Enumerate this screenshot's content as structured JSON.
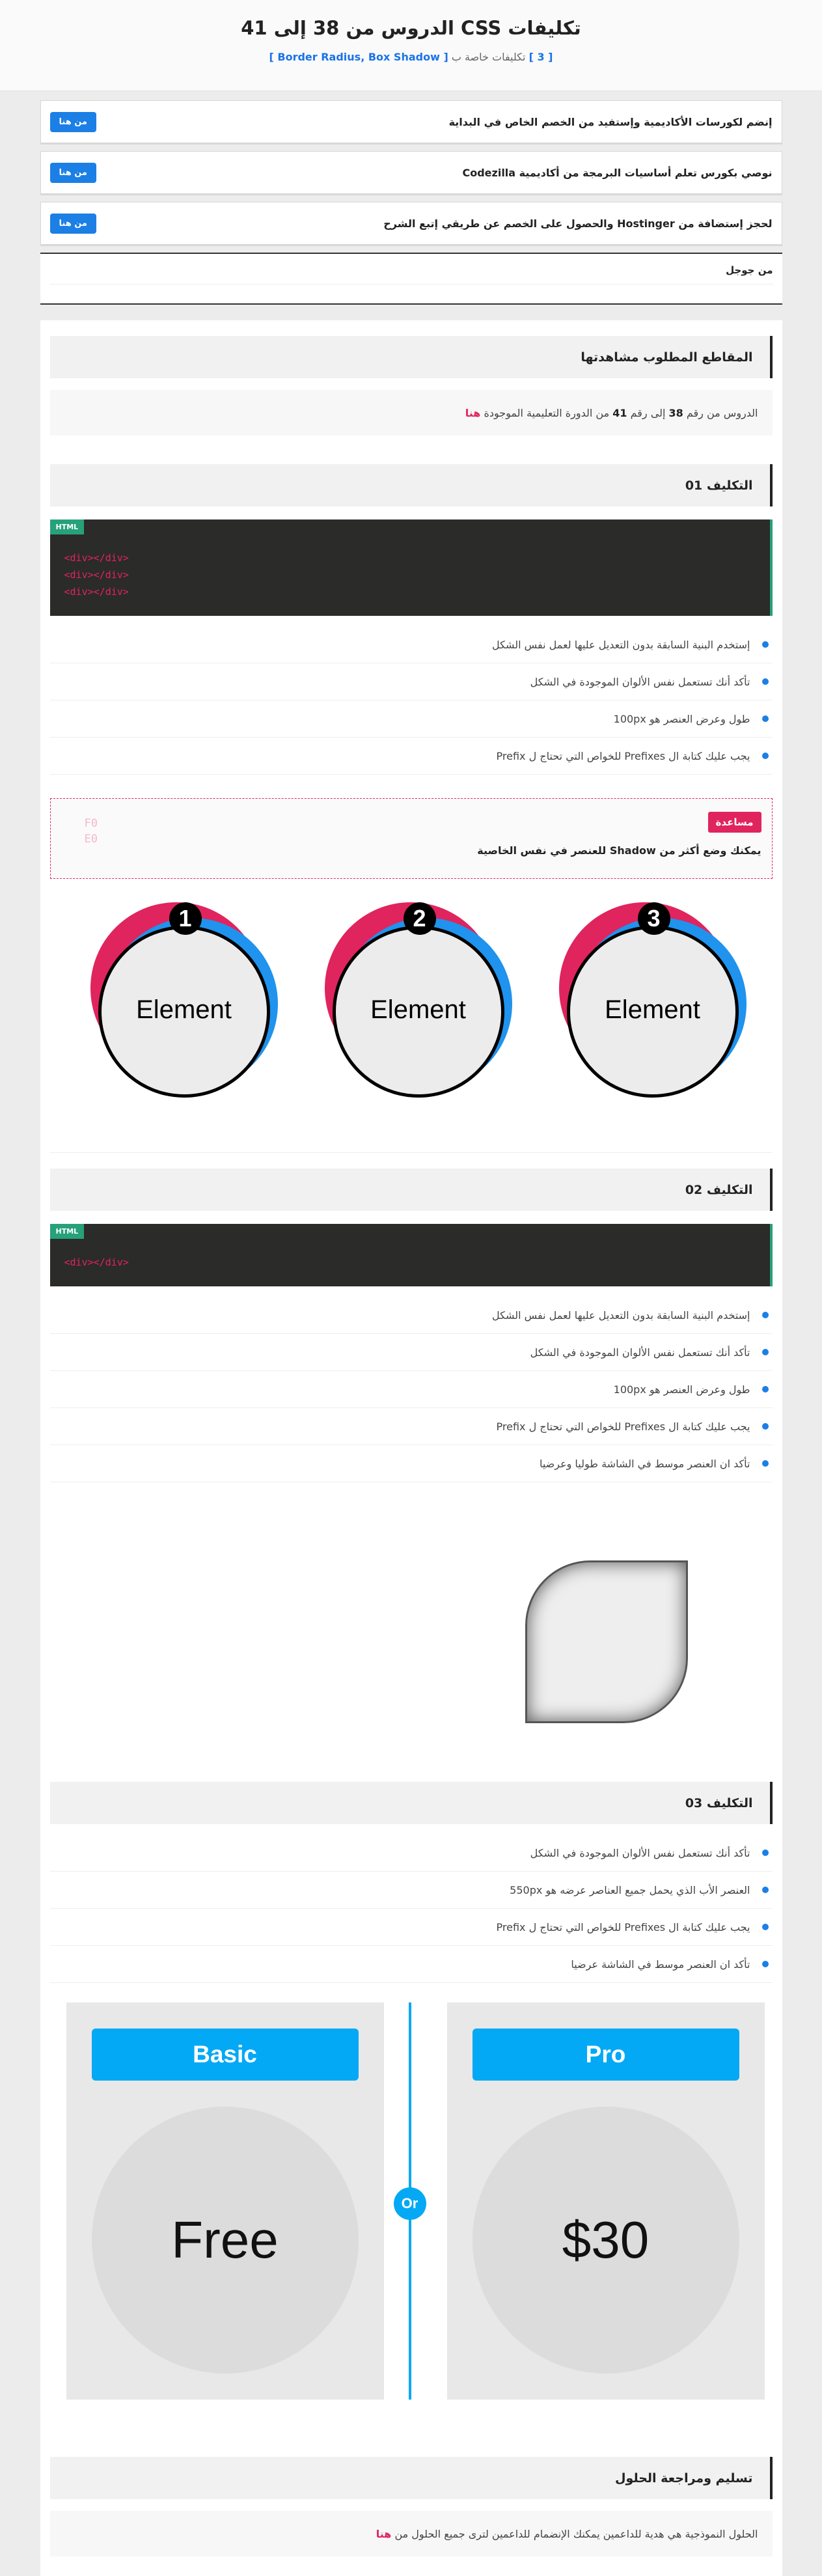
{
  "header": {
    "title": "تكليفات CSS الدروس من 38 إلى 41",
    "subtitle_prefix": "[ 3 ]",
    "subtitle_middle": "تكليفات خاصة ب",
    "subtitle_topics": "[ Border Radius, Box Shadow ]"
  },
  "ads": [
    {
      "text": "إنضم لكورسات الأكاديمية وإستفيد من الخصم الخاص في البداية",
      "button": "من هنا"
    },
    {
      "text": "نوصي بكورس تعلم أساسيات البرمجة من أكاديمية Codezilla",
      "button": "من هنا"
    },
    {
      "text": "لحجز إستضافة من Hostinger والحصول على الخصم عن طريقي إتبع الشرح",
      "button": "من هنا"
    }
  ],
  "google_box": {
    "text": "من جوجل"
  },
  "videos": {
    "title": "المقاطع المطلوب مشاهدتها",
    "note_pre": "الدروس من رقم",
    "note_from": "38",
    "note_mid": "إلى رقم",
    "note_to": "41",
    "note_post": "من الدورة التعليمية الموجودة",
    "note_link": "هنا"
  },
  "assignment1": {
    "title": "التكليف 01",
    "code_tag": "HTML",
    "code_lines": [
      "<div></div>",
      "<div></div>",
      "<div></div>"
    ],
    "requirements": [
      "إستخدم البنية السابقة بدون التعديل عليها لعمل نفس الشكل",
      "تأكد أنك تستعمل نفس الألوان الموجودة في الشكل",
      "طول وعرض العنصر هو 100px",
      "يجب عليك كتابة ال Prefixes للخواص التي تحتاج ل Prefix"
    ],
    "help_badge": "مساعدة",
    "help_text": "يمكنك وضع أكثر من Shadow للعنصر في نفس الخاصية",
    "help_ghost": [
      "F0",
      "E0"
    ],
    "elements": [
      {
        "number": "1",
        "label": "Element"
      },
      {
        "number": "2",
        "label": "Element"
      },
      {
        "number": "3",
        "label": "Element"
      }
    ]
  },
  "assignment2": {
    "title": "التكليف 02",
    "code_tag": "HTML",
    "code_lines": [
      "<div></div>"
    ],
    "requirements": [
      "إستخدم البنية السابقة بدون التعديل عليها لعمل نفس الشكل",
      "تأكد أنك تستعمل نفس الألوان الموجودة في الشكل",
      "طول وعرض العنصر هو 100px",
      "يجب عليك كتابة ال Prefixes للخواص التي تحتاج ل Prefix",
      "تأكد ان العنصر موسط في الشاشة طوليا وعرضيا"
    ]
  },
  "assignment3": {
    "title": "التكليف 03",
    "requirements": [
      "تأكد أنك تستعمل نفس الألوان الموجودة في الشكل",
      "العنصر الأب الذي يحمل جميع العناصر عرضه هو 550px",
      "يجب عليك كتابة ال Prefixes للخواص التي تحتاج ل Prefix",
      "تأكد ان العنصر موسط في الشاشة عرضيا"
    ],
    "plans": [
      {
        "name": "Basic",
        "price": "Free"
      },
      {
        "name": "Pro",
        "price": "$30"
      }
    ],
    "or_label": "Or"
  },
  "solutions": {
    "title": "تسليم ومراجعة الحلول",
    "note_pre": "الحلول النموذجية هي هدية للداعمين يمكنك الإنضمام للداعمين لترى جميع الحلول من",
    "note_link": "هنا"
  },
  "colors": {
    "accent_blue": "#1c7fe6",
    "pink": "#e0245e",
    "sky": "#03a9f4",
    "code_green": "#26a17a"
  }
}
